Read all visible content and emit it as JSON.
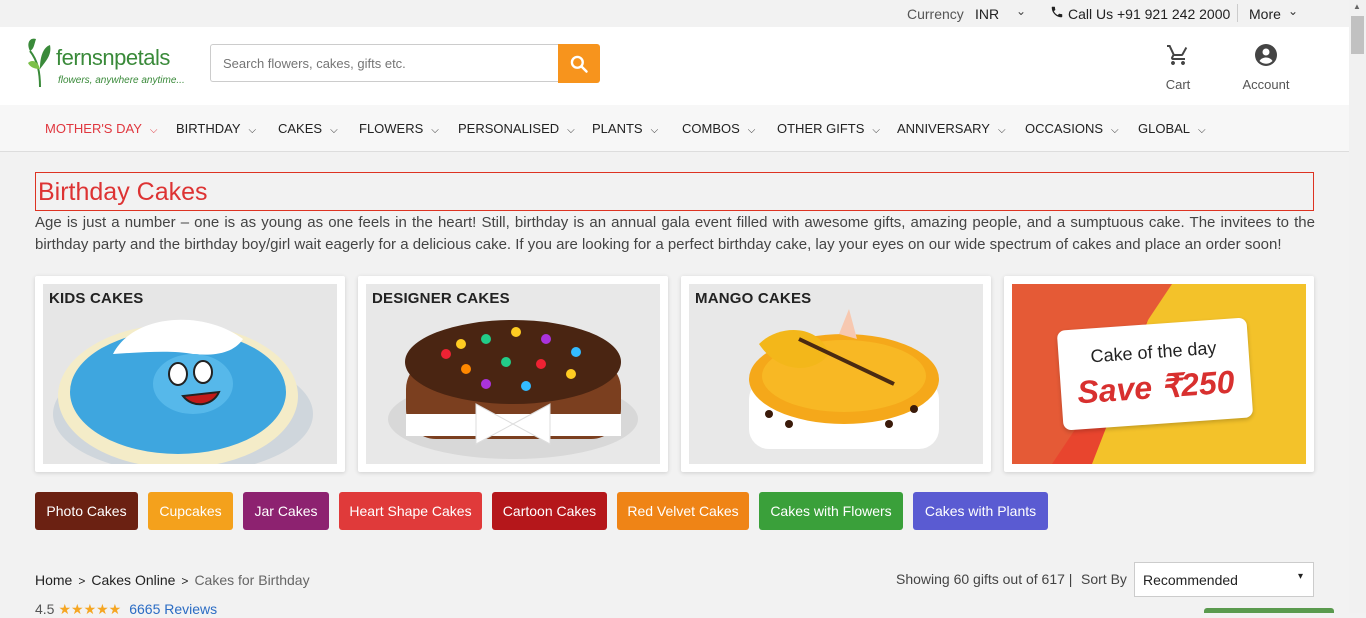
{
  "topbar": {
    "currency_label": "Currency",
    "currency_value": "INR",
    "call_text": "Call Us +91 921 242 2000",
    "more_label": "More"
  },
  "header": {
    "brand": "fernsnpetals",
    "tagline": "flowers, anywhere anytime...",
    "search_placeholder": "Search flowers, cakes, gifts etc.",
    "cart_label": "Cart",
    "account_label": "Account"
  },
  "nav": [
    "MOTHER'S DAY",
    "BIRTHDAY",
    "CAKES",
    "FLOWERS",
    "PERSONALISED",
    "PLANTS",
    "COMBOS",
    "OTHER GIFTS",
    "ANNIVERSARY",
    "OCCASIONS",
    "GLOBAL"
  ],
  "page": {
    "title": "Birthday Cakes",
    "description": "Age is just a number – one is as young as one feels in the heart! Still, birthday is an annual gala event filled with awesome gifts, amazing people, and a sumptuous cake. The invitees to the birthday party and the birthday boy/girl wait eagerly for a delicious cake. If you are looking for a perfect birthday cake, lay your eyes on our wide spectrum of cakes and place an order soon!"
  },
  "cards": [
    "KIDS CAKES",
    "DESIGNER CAKES",
    "MANGO CAKES"
  ],
  "promo": {
    "line1": "Cake of the day",
    "line2": "Save ₹250"
  },
  "chips": [
    {
      "label": "Photo Cakes",
      "color": "#6b2112"
    },
    {
      "label": "Cupcakes",
      "color": "#f4a11c"
    },
    {
      "label": "Jar Cakes",
      "color": "#8d2270"
    },
    {
      "label": "Heart Shape Cakes",
      "color": "#e03a3a"
    },
    {
      "label": "Cartoon Cakes",
      "color": "#b5171b"
    },
    {
      "label": "Red Velvet Cakes",
      "color": "#ef8416"
    },
    {
      "label": "Cakes with Flowers",
      "color": "#3aa03a"
    },
    {
      "label": "Cakes with Plants",
      "color": "#5a5bd2"
    }
  ],
  "breadcrumb": [
    "Home",
    "Cakes Online",
    "Cakes for Birthday"
  ],
  "rating": {
    "score": "4.5",
    "stars": "★★★★★",
    "reviews": "6665 Reviews"
  },
  "listing": {
    "showing": "Showing 60 gifts out of 617 |",
    "sort_label": "Sort By",
    "sort_value": "Recommended"
  }
}
